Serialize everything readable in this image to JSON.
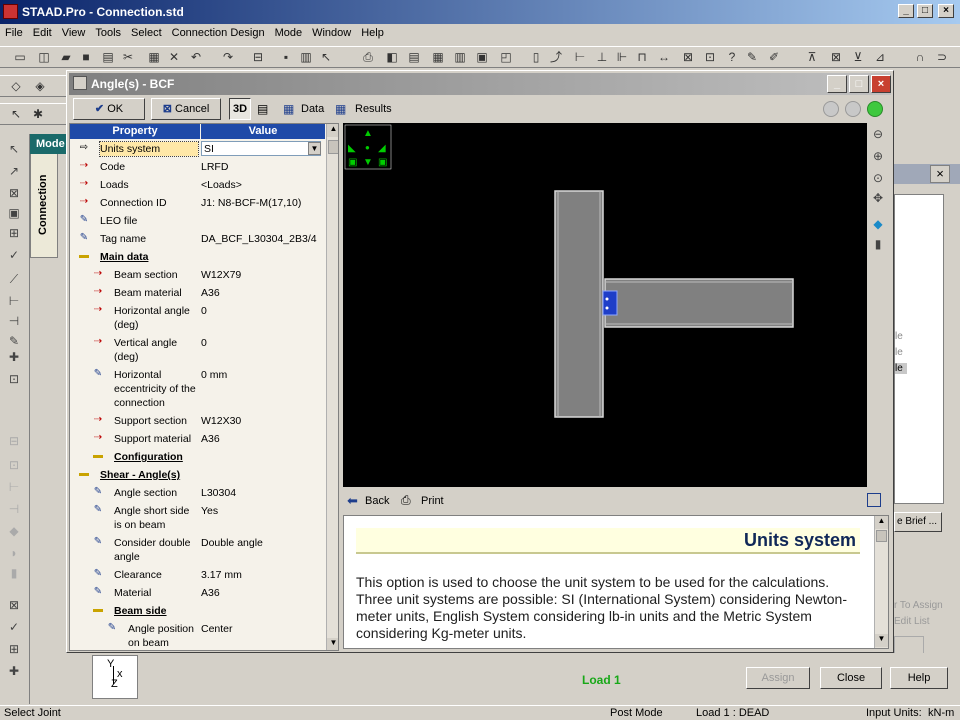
{
  "app": {
    "title": "STAAD.Pro - Connection.std",
    "menu": [
      "File",
      "Edit",
      "View",
      "Tools",
      "Select",
      "Connection Design",
      "Mode",
      "Window",
      "Help"
    ]
  },
  "side": {
    "tab_label": "Connection",
    "mode_label": "Mode"
  },
  "dialog": {
    "title": "Angle(s) - BCF",
    "ok_label": "OK",
    "cancel_label": "Cancel",
    "tab_3d": "3D",
    "tab_data": "Data",
    "tab_results": "Results",
    "columns": {
      "property": "Property",
      "value": "Value"
    },
    "rows": [
      {
        "icon": "arrow-icon",
        "kind": "arrow",
        "indent": 0,
        "name": "Units system",
        "value": "SI",
        "selected": true
      },
      {
        "icon": "input-red-icon",
        "kind": "red",
        "indent": 0,
        "name": "Code",
        "value": "LRFD"
      },
      {
        "icon": "input-red-icon",
        "kind": "red",
        "indent": 0,
        "name": "Loads",
        "value": "<Loads>"
      },
      {
        "icon": "input-red-icon",
        "kind": "red",
        "indent": 0,
        "name": "Connection ID",
        "value": "J1:  N8-BCF-M(17,10)"
      },
      {
        "icon": "edit-icon",
        "kind": "blue",
        "indent": 0,
        "name": "LEO file",
        "value": ""
      },
      {
        "icon": "edit-icon",
        "kind": "blue",
        "indent": 0,
        "name": "Tag name",
        "value": "DA_BCF_L30304_2B3/4"
      },
      {
        "icon": "folder-icon",
        "kind": "fold",
        "indent": 0,
        "name": "Main data",
        "value": "",
        "group": true
      },
      {
        "icon": "input-red-icon",
        "kind": "red",
        "indent": 1,
        "name": "Beam section",
        "value": "W12X79"
      },
      {
        "icon": "input-red-icon",
        "kind": "red",
        "indent": 1,
        "name": "Beam material",
        "value": "A36"
      },
      {
        "icon": "input-red-icon",
        "kind": "red",
        "indent": 1,
        "name": "Horizontal angle (deg)",
        "value": "0",
        "lines": 2
      },
      {
        "icon": "input-red-icon",
        "kind": "red",
        "indent": 1,
        "name": "Vertical angle (deg)",
        "value": "0",
        "lines": 2
      },
      {
        "icon": "edit-icon",
        "kind": "blue",
        "indent": 1,
        "name": "Horizontal eccentricity of the connection",
        "value": "0 mm",
        "lines": 3
      },
      {
        "icon": "input-red-icon",
        "kind": "red",
        "indent": 1,
        "name": "Support section",
        "value": "W12X30"
      },
      {
        "icon": "input-red-icon",
        "kind": "red",
        "indent": 1,
        "name": "Support material",
        "value": "A36"
      },
      {
        "icon": "folder-icon",
        "kind": "fold",
        "indent": 1,
        "name": "Configuration",
        "value": "",
        "group": true
      },
      {
        "icon": "folder-icon",
        "kind": "fold",
        "indent": 0,
        "name": "Shear - Angle(s)",
        "value": "",
        "group": true
      },
      {
        "icon": "edit-icon",
        "kind": "blue",
        "indent": 1,
        "name": "Angle section",
        "value": "L30304"
      },
      {
        "icon": "edit-icon",
        "kind": "blue",
        "indent": 1,
        "name": "Angle short side is on beam",
        "value": "Yes",
        "lines": 2
      },
      {
        "icon": "edit-icon",
        "kind": "blue",
        "indent": 1,
        "name": "Consider double angle",
        "value": "Double angle",
        "lines": 2
      },
      {
        "icon": "edit-icon",
        "kind": "blue",
        "indent": 1,
        "name": "Clearance",
        "value": "3.17  mm"
      },
      {
        "icon": "edit-icon",
        "kind": "blue",
        "indent": 1,
        "name": "Material",
        "value": "A36"
      },
      {
        "icon": "folder-icon",
        "kind": "fold",
        "indent": 1,
        "name": "Beam  side",
        "value": "",
        "group": true
      },
      {
        "icon": "edit-icon",
        "kind": "blue",
        "indent": 2,
        "name": "Angle position on beam",
        "value": "Center",
        "lines": 2
      }
    ],
    "help": {
      "back_label": "Back",
      "print_label": "Print",
      "heading": "Units system",
      "body": "This option is used to choose the unit system to be used for the calculations. Three unit systems are possible: SI (International System) considering Newton-meter units, English System considering lb-in units and the Metric System considering Kg-meter units."
    }
  },
  "right_panel": {
    "brief_label": "e Brief ...",
    "assign_to_label": "r To Assign",
    "edit_list_label": "Edit List",
    "frag": [
      "le",
      "le",
      "le"
    ]
  },
  "bottom": {
    "load_label": "Load 1",
    "assign_button": "Assign",
    "close_button": "Close",
    "help_button": "Help"
  },
  "status": {
    "left": "Select Joint",
    "mode": "Post Mode",
    "load": "Load 1 : DEAD",
    "units_label": "Input Units:",
    "units": "kN-m"
  },
  "colors": {
    "accent": "#0a246a",
    "grid_header": "#1f4aa8",
    "help_heading_bg": "#ffffe0",
    "load_green": "#18a818"
  }
}
